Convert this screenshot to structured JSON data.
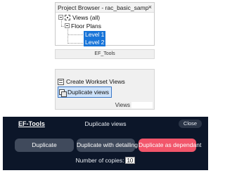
{
  "project_browser": {
    "title": "Project Browser - rac_basic_sample...",
    "close_glyph": "×",
    "tree": {
      "views_label": "Views (all)",
      "floor_plans_label": "Floor Plans",
      "levels": [
        "Level 1",
        "Level 2"
      ]
    }
  },
  "ribbon": {
    "tab_label": "EF_Tools"
  },
  "workset_panel": {
    "create_label": "Create Workset Views",
    "duplicate_label": "Duplicate views",
    "footer_label": "Views"
  },
  "dialog": {
    "logo": "EF-Tools",
    "title": "Duplicate views",
    "close_label": "Close",
    "buttons": {
      "duplicate": "Duplicate",
      "with_detailing": "Duplicate with detailing",
      "as_dependant": "Duplicate as dependant"
    },
    "copies_label": "Number of copies:",
    "copies_value": "10",
    "colors": {
      "background": "#0c1629",
      "button": "#404a5c",
      "accent": "#f2566b"
    }
  }
}
